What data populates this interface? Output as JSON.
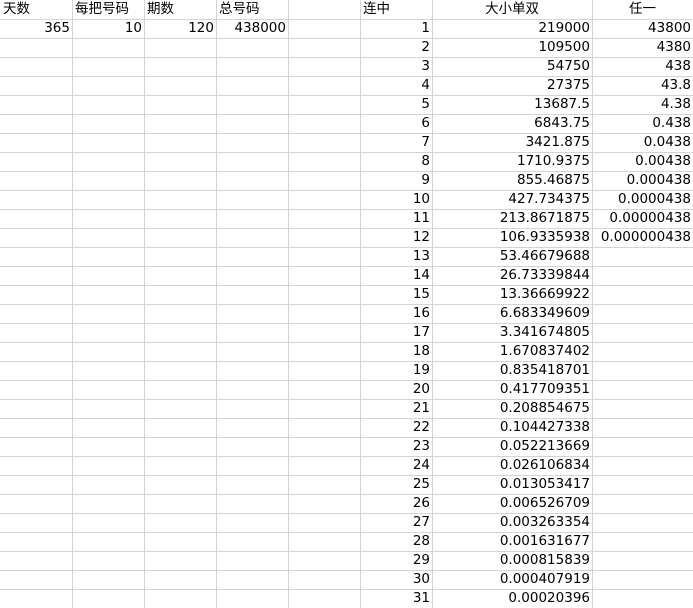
{
  "left_headers": [
    "天数",
    "每把号码",
    "期数",
    "总号码"
  ],
  "left_values": [
    "365",
    "10",
    "120",
    "438000"
  ],
  "right_headers": {
    "lianzhong": "连中",
    "daxiaodanshuang": "大小单双",
    "renyi": "任一"
  },
  "rows": [
    {
      "n": "1",
      "dx": "219000",
      "ry": "43800"
    },
    {
      "n": "2",
      "dx": "109500",
      "ry": "4380"
    },
    {
      "n": "3",
      "dx": "54750",
      "ry": "438"
    },
    {
      "n": "4",
      "dx": "27375",
      "ry": "43.8"
    },
    {
      "n": "5",
      "dx": "13687.5",
      "ry": "4.38"
    },
    {
      "n": "6",
      "dx": "6843.75",
      "ry": "0.438"
    },
    {
      "n": "7",
      "dx": "3421.875",
      "ry": "0.0438"
    },
    {
      "n": "8",
      "dx": "1710.9375",
      "ry": "0.00438"
    },
    {
      "n": "9",
      "dx": "855.46875",
      "ry": "0.000438"
    },
    {
      "n": "10",
      "dx": "427.734375",
      "ry": "0.0000438"
    },
    {
      "n": "11",
      "dx": "213.8671875",
      "ry": "0.00000438"
    },
    {
      "n": "12",
      "dx": "106.9335938",
      "ry": "0.000000438"
    },
    {
      "n": "13",
      "dx": "53.46679688",
      "ry": ""
    },
    {
      "n": "14",
      "dx": "26.73339844",
      "ry": ""
    },
    {
      "n": "15",
      "dx": "13.36669922",
      "ry": ""
    },
    {
      "n": "16",
      "dx": "6.683349609",
      "ry": ""
    },
    {
      "n": "17",
      "dx": "3.341674805",
      "ry": ""
    },
    {
      "n": "18",
      "dx": "1.670837402",
      "ry": ""
    },
    {
      "n": "19",
      "dx": "0.835418701",
      "ry": ""
    },
    {
      "n": "20",
      "dx": "0.417709351",
      "ry": ""
    },
    {
      "n": "21",
      "dx": "0.208854675",
      "ry": ""
    },
    {
      "n": "22",
      "dx": "0.104427338",
      "ry": ""
    },
    {
      "n": "23",
      "dx": "0.052213669",
      "ry": ""
    },
    {
      "n": "24",
      "dx": "0.026106834",
      "ry": ""
    },
    {
      "n": "25",
      "dx": "0.013053417",
      "ry": ""
    },
    {
      "n": "26",
      "dx": "0.006526709",
      "ry": ""
    },
    {
      "n": "27",
      "dx": "0.003263354",
      "ry": ""
    },
    {
      "n": "28",
      "dx": "0.001631677",
      "ry": ""
    },
    {
      "n": "29",
      "dx": "0.000815839",
      "ry": ""
    },
    {
      "n": "30",
      "dx": "0.000407919",
      "ry": ""
    },
    {
      "n": "31",
      "dx": "0.00020396",
      "ry": ""
    }
  ]
}
